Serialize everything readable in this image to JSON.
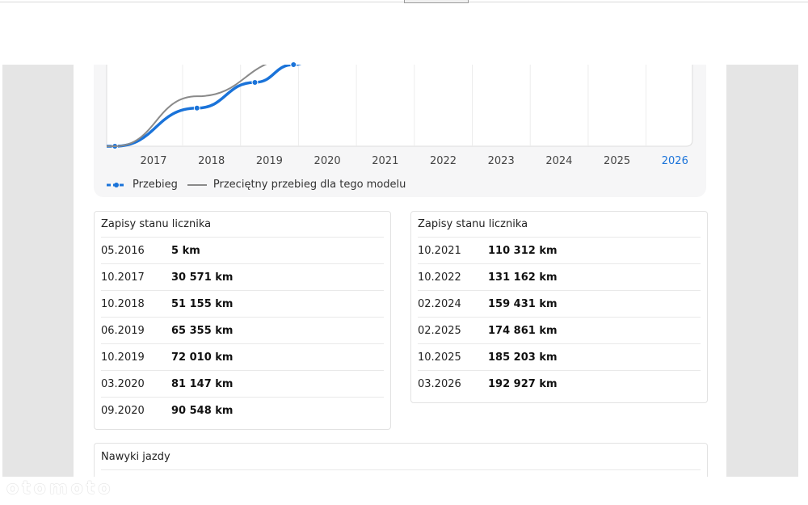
{
  "chart_data": {
    "type": "line",
    "x_ticks": [
      "2017",
      "2018",
      "2019",
      "2020",
      "2021",
      "2022",
      "2023",
      "2024",
      "2025",
      "2026"
    ],
    "highlight_tick": "2026",
    "series": [
      {
        "name": "Przebieg",
        "color": "#1a73d9",
        "style": "solid-with-markers",
        "points": [
          [
            "05.2016",
            5
          ],
          [
            "10.2017",
            30571
          ],
          [
            "10.2018",
            51155
          ],
          [
            "06.2019",
            65355
          ]
        ]
      },
      {
        "name": "Przeciętny przebieg dla tego modelu",
        "color": "#8a8a8a",
        "style": "solid",
        "points": [
          [
            "05.2016",
            5
          ],
          [
            "10.2017",
            40000
          ],
          [
            "06.2019",
            70000
          ]
        ]
      }
    ],
    "grid": true,
    "legend": "bottom-left"
  },
  "legend": {
    "series1": "Przebieg",
    "series2": "Przeciętny przebieg dla tego modelu"
  },
  "records_left": {
    "title": "Zapisy stanu licznika",
    "rows": [
      {
        "date": "05.2016",
        "value": "5 km"
      },
      {
        "date": "10.2017",
        "value": "30 571 km"
      },
      {
        "date": "10.2018",
        "value": "51 155 km"
      },
      {
        "date": "06.2019",
        "value": "65 355 km"
      },
      {
        "date": "10.2019",
        "value": "72 010 km"
      },
      {
        "date": "03.2020",
        "value": "81 147 km"
      },
      {
        "date": "09.2020",
        "value": "90 548 km"
      }
    ]
  },
  "records_right": {
    "title": "Zapisy stanu licznika",
    "rows": [
      {
        "date": "10.2021",
        "value": "110 312 km"
      },
      {
        "date": "10.2022",
        "value": "131 162 km"
      },
      {
        "date": "02.2024",
        "value": "159 431 km"
      },
      {
        "date": "02.2025",
        "value": "174 861 km"
      },
      {
        "date": "10.2025",
        "value": "185 203 km"
      },
      {
        "date": "03.2026",
        "value": "192 927 km"
      }
    ]
  },
  "habits": {
    "title": "Nawyki jazdy"
  },
  "watermark": "otomoto"
}
